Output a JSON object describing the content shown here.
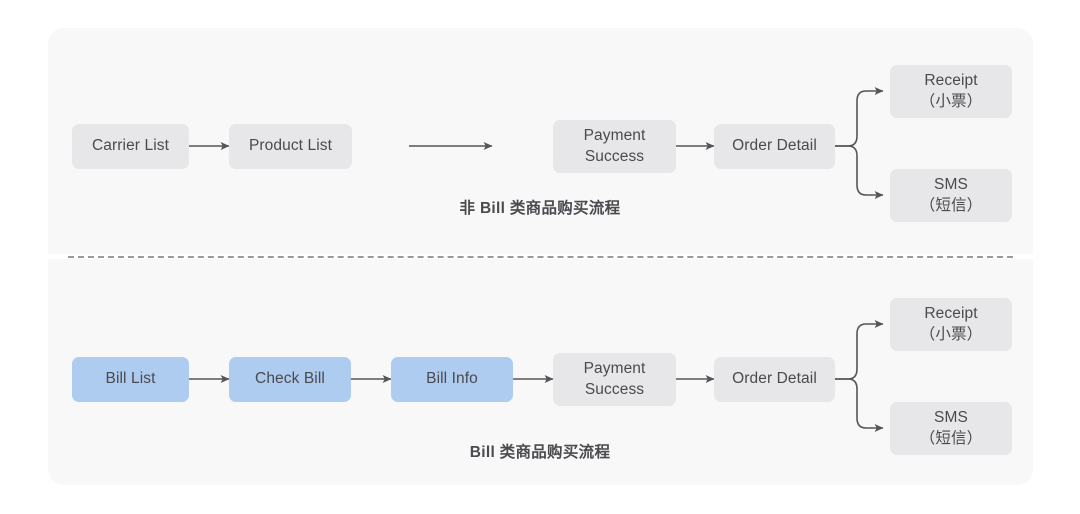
{
  "diagram": {
    "title_top": "非 Bill 类商品购买流程",
    "title_bottom": "Bill 类商品购买流程",
    "colors": {
      "page_background": "#ffffff",
      "panel_background": "#f8f8f9",
      "node_gray": "#e7e7e9",
      "node_blue": "#aecbf0",
      "text": "#4a4a4f",
      "arrow": "#555558",
      "divider": "#9a9a9e"
    }
  },
  "flows": {
    "non_bill": {
      "caption": "非 Bill 类商品购买流程",
      "nodes": [
        {
          "id": "carrier-list",
          "label": "Carrier List",
          "style": "gray"
        },
        {
          "id": "product-list",
          "label": "Product List",
          "style": "gray"
        },
        {
          "id": "payment-success",
          "label": "Payment\nSuccess",
          "line1": "Payment",
          "line2": "Success",
          "style": "gray"
        },
        {
          "id": "order-detail",
          "label": "Order Detail",
          "style": "gray"
        },
        {
          "id": "receipt",
          "label": "Receipt\n（小票）",
          "line1": "Receipt",
          "line2": "（小票）",
          "style": "gray"
        },
        {
          "id": "sms",
          "label": "SMS\n（短信）",
          "line1": "SMS",
          "line2": "（短信）",
          "style": "gray"
        }
      ],
      "edges": [
        {
          "from": "carrier-list",
          "to": "product-list",
          "type": "straight"
        },
        {
          "from": "product-list",
          "to": "payment-success",
          "type": "straight-gap"
        },
        {
          "from": "payment-success",
          "to": "order-detail",
          "type": "straight"
        },
        {
          "from": "order-detail",
          "to": "receipt",
          "type": "branch-up"
        },
        {
          "from": "order-detail",
          "to": "sms",
          "type": "branch-down"
        }
      ]
    },
    "bill": {
      "caption": "Bill 类商品购买流程",
      "nodes": [
        {
          "id": "bill-list",
          "label": "Bill List",
          "style": "blue"
        },
        {
          "id": "check-bill",
          "label": "Check Bill",
          "style": "blue"
        },
        {
          "id": "bill-info",
          "label": "Bill Info",
          "style": "blue"
        },
        {
          "id": "payment-success",
          "label": "Payment\nSuccess",
          "line1": "Payment",
          "line2": "Success",
          "style": "gray"
        },
        {
          "id": "order-detail",
          "label": "Order Detail",
          "style": "gray"
        },
        {
          "id": "receipt",
          "label": "Receipt\n（小票）",
          "line1": "Receipt",
          "line2": "（小票）",
          "style": "gray"
        },
        {
          "id": "sms",
          "label": "SMS\n（短信）",
          "line1": "SMS",
          "line2": "（短信）",
          "style": "gray"
        }
      ],
      "edges": [
        {
          "from": "bill-list",
          "to": "check-bill",
          "type": "straight"
        },
        {
          "from": "check-bill",
          "to": "bill-info",
          "type": "straight"
        },
        {
          "from": "bill-info",
          "to": "payment-success",
          "type": "straight"
        },
        {
          "from": "payment-success",
          "to": "order-detail",
          "type": "straight"
        },
        {
          "from": "order-detail",
          "to": "receipt",
          "type": "branch-up"
        },
        {
          "from": "order-detail",
          "to": "sms",
          "type": "branch-down"
        }
      ]
    }
  }
}
